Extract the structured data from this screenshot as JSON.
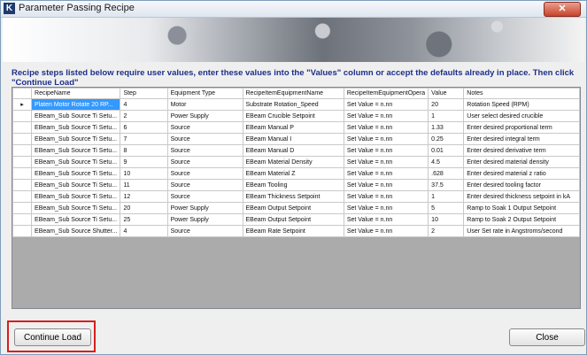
{
  "window": {
    "title": "Parameter Passing Recipe",
    "close_glyph": "✕",
    "app_icon_letter": "K"
  },
  "instructions": "Recipe steps listed below require user values, enter these values into the \"Values\" column or accept the defaults already in place. Then click \"Continue Load\"",
  "grid": {
    "columns": [
      "RecipeName",
      "Step",
      "Equipment Type",
      "RecipeItemEquipmentName",
      "RecipeItemEquipmentOpera",
      "Value",
      "Notes"
    ],
    "rows": [
      [
        "Platen Motor Rotate 20 RP...",
        "4",
        "Motor",
        "Substrate Rotation_Speed",
        "Set Value = n.nn",
        "20",
        "Rotation Speed (RPM)"
      ],
      [
        "EBeam_Sub Source Ti Setu...",
        "2",
        "Power Supply",
        "EBeam Crucible Setpoint",
        "Set Value = n.nn",
        "1",
        "User select desired crucible"
      ],
      [
        "EBeam_Sub Source Ti Setu...",
        "6",
        "Source",
        "EBeam Manual P",
        "Set Value = n.nn",
        "1.33",
        "Enter desired proportional term"
      ],
      [
        "EBeam_Sub Source Ti Setu...",
        "7",
        "Source",
        "EBeam Manual I",
        "Set Value = n.nn",
        "0.25",
        "Enter desired integral term"
      ],
      [
        "EBeam_Sub Source Ti Setu...",
        "8",
        "Source",
        "EBeam Manual D",
        "Set Value = n.nn",
        "0.01",
        "Enter desired derivative term"
      ],
      [
        "EBeam_Sub Source Ti Setu...",
        "9",
        "Source",
        "EBeam Material Density",
        "Set Value = n.nn",
        "4.5",
        "Enter desired material density"
      ],
      [
        "EBeam_Sub Source Ti Setu...",
        "10",
        "Source",
        "EBeam Material Z",
        "Set Value = n.nn",
        ".628",
        "Enter desired material z ratio"
      ],
      [
        "EBeam_Sub Source Ti Setu...",
        "11",
        "Source",
        "EBeam Tooling",
        "Set Value = n.nn",
        "37.5",
        "Enter desired tooling factor"
      ],
      [
        "EBeam_Sub Source Ti Setu...",
        "12",
        "Source",
        "EBeam Thickness Setpoint",
        "Set Value = n.nn",
        "1",
        "Enter desired thickness setpoint in kA"
      ],
      [
        "EBeam_Sub Source Ti Setu...",
        "20",
        "Power Supply",
        "EBeam Output Setpoint",
        "Set Value = n.nn",
        "5",
        "Ramp to Soak 1 Output Setpoint"
      ],
      [
        "EBeam_Sub Source Ti Setu...",
        "25",
        "Power Supply",
        "EBeam Output Setpoint",
        "Set Value = n.nn",
        "10",
        "Ramp to Soak 2 Output Setpoint"
      ],
      [
        "EBeam_Sub Source Shutter...",
        "4",
        "Source",
        "EBeam Rate Setpoint",
        "Set Value = n.nn",
        "2",
        "User Set rate in Angstroms/second"
      ]
    ],
    "selected_row_marker": "▸"
  },
  "buttons": {
    "continue_load": "Continue Load",
    "close": "Close"
  }
}
